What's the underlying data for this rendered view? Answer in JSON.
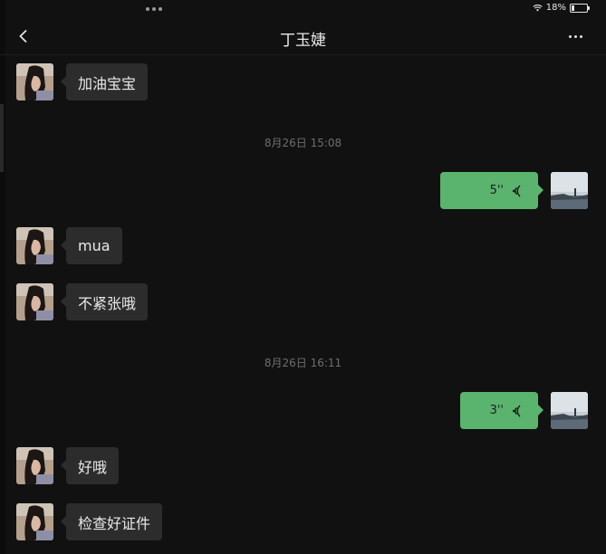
{
  "status": {
    "battery": "18%"
  },
  "nav": {
    "title": "丁玉婕"
  },
  "messages": [
    {
      "kind": "in",
      "text": "加油宝宝"
    },
    {
      "kind": "time",
      "text": "8月26日 15:08"
    },
    {
      "kind": "out-voice",
      "duration": "5''"
    },
    {
      "kind": "in",
      "text": "mua"
    },
    {
      "kind": "in",
      "text": "不紧张哦"
    },
    {
      "kind": "time",
      "text": "8月26日 16:11"
    },
    {
      "kind": "out-voice",
      "duration": "3''"
    },
    {
      "kind": "in",
      "text": "好哦"
    },
    {
      "kind": "in",
      "text": "检查好证件"
    }
  ],
  "colors": {
    "background": "#111111",
    "incoming_bubble": "#2c2c2c",
    "outgoing_bubble": "#5ab46e"
  }
}
